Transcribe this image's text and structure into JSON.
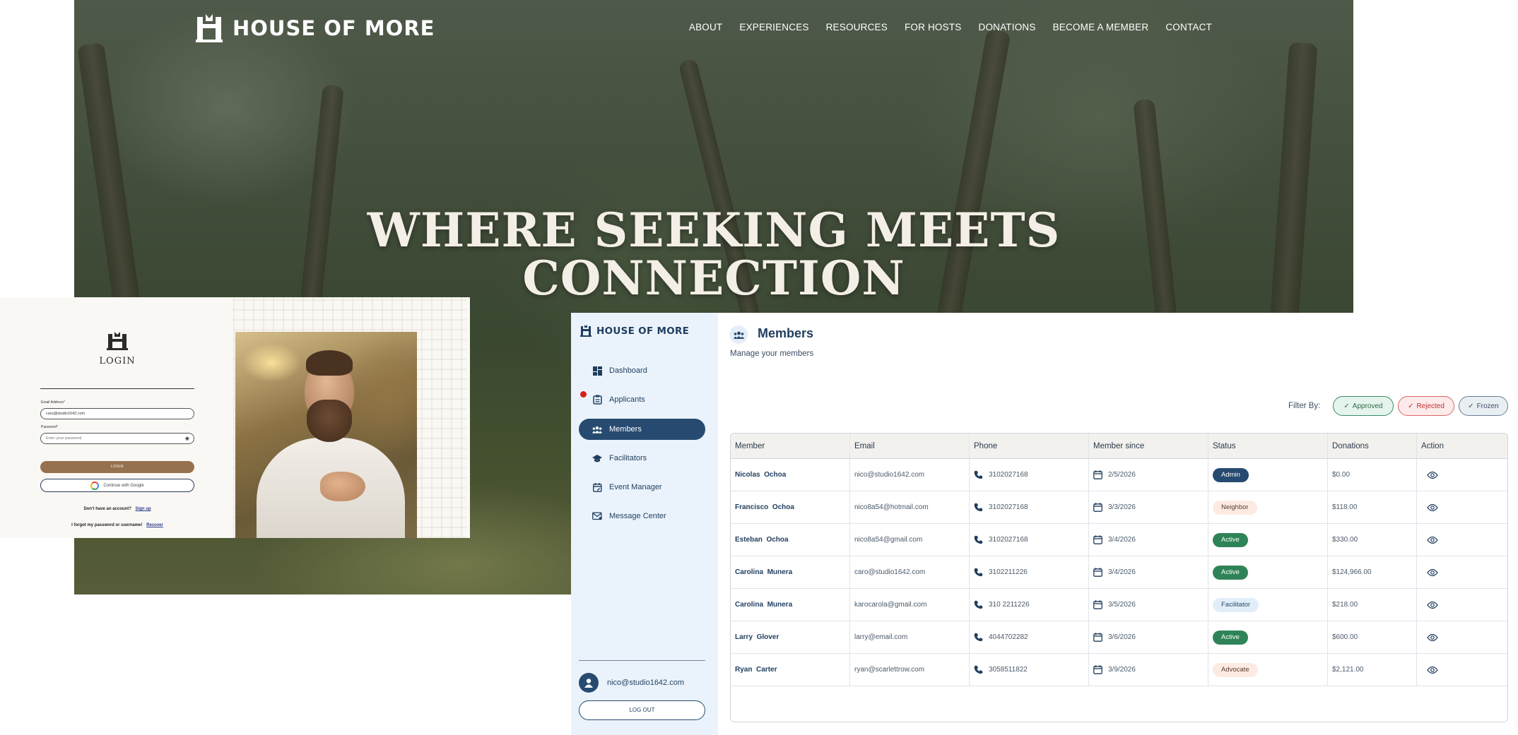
{
  "website": {
    "brand": "HOUSE OF MORE",
    "nav": [
      "ABOUT",
      "EXPERIENCES",
      "RESOURCES",
      "FOR HOSTS",
      "DONATIONS",
      "BECOME A MEMBER",
      "CONTACT"
    ],
    "hero_title_line1": "WHERE SEEKING MEETS",
    "hero_title_line2": "CONNECTION"
  },
  "login": {
    "title": "LOGIN",
    "email_label": "Email Address*",
    "email_value": "caro@studio1642.com",
    "password_label": "Password*",
    "password_placeholder": "Enter your password",
    "login_button": "LOGIN",
    "google_button": "Continue with Google",
    "no_account_text": "Don't have an account?",
    "signup_link": "Sign up",
    "forgot_text": "I forgot my password or username!",
    "recover_link": "Recover"
  },
  "app": {
    "brand": "HOUSE OF MORE",
    "sidebar": {
      "items": [
        {
          "label": "Dashboard",
          "icon": "dashboard-icon"
        },
        {
          "label": "Applicants",
          "icon": "clipboard-icon"
        },
        {
          "label": "Members",
          "icon": "group-icon"
        },
        {
          "label": "Facilitators",
          "icon": "graduation-cap-icon"
        },
        {
          "label": "Event Manager",
          "icon": "calendar-edit-icon"
        },
        {
          "label": "Message Center",
          "icon": "mail-icon"
        }
      ],
      "active": "Members",
      "user_email": "nico@studio1642.com",
      "logout": "LOG OUT"
    },
    "page": {
      "title": "Members",
      "subtitle": "Manage your members",
      "filter_label": "Filter By:",
      "filters": [
        "Approved",
        "Rejected",
        "Frozen"
      ]
    },
    "table": {
      "columns": [
        "Member",
        "Email",
        "Phone",
        "Member since",
        "Status",
        "Donations",
        "Action"
      ],
      "rows": [
        {
          "first": "Nicolas",
          "last": "Ochoa",
          "email": "nico@studio1642.com",
          "phone": "3102027168",
          "since": "2/5/2026",
          "status": "Admin",
          "donations": "$0.00"
        },
        {
          "first": "Francisco",
          "last": "Ochoa",
          "email": "nico8a54@hotmail.com",
          "phone": "3102027168",
          "since": "3/3/2026",
          "status": "Neighbor",
          "donations": "$118.00"
        },
        {
          "first": "Esteban",
          "last": "Ochoa",
          "email": "nico8a54@gmail.com",
          "phone": "3102027168",
          "since": "3/4/2026",
          "status": "Active",
          "donations": "$330.00"
        },
        {
          "first": "Carolina",
          "last": "Munera",
          "email": "caro@studio1642.com",
          "phone": "3102211226",
          "since": "3/4/2026",
          "status": "Active",
          "donations": "$124,966.00"
        },
        {
          "first": "Carolina",
          "last": "Munera",
          "email": "karocarola@gmail.com",
          "phone": "310 2211226",
          "since": "3/5/2026",
          "status": "Facilitator",
          "donations": "$218.00"
        },
        {
          "first": "Larry",
          "last": "Glover",
          "email": "larry@email.com",
          "phone": "4044702282",
          "since": "3/6/2026",
          "status": "Active",
          "donations": "$600.00"
        },
        {
          "first": "Ryan",
          "last": "Carter",
          "email": "ryan@scarlettrow.com",
          "phone": "3058511822",
          "since": "3/9/2026",
          "status": "Advocate",
          "donations": "$2,121.00"
        }
      ]
    },
    "colors": {
      "navy": "#274a70",
      "active_green": "#2f8457",
      "sidebar_bg": "#eaf3fb",
      "notification_red": "#d81e1e"
    }
  }
}
